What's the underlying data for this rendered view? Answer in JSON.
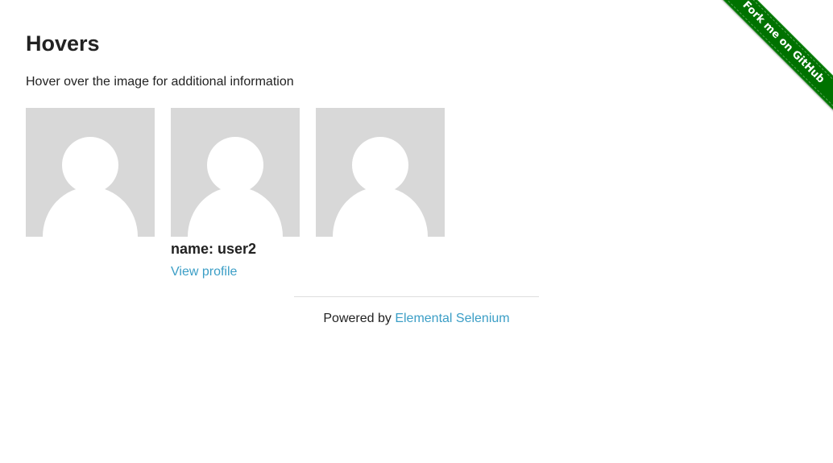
{
  "page": {
    "title": "Hovers",
    "subtitle": "Hover over the image for additional information"
  },
  "figures": [
    {
      "avatar_icon": "user-avatar-icon",
      "caption_name": "",
      "caption_link": ""
    },
    {
      "avatar_icon": "user-avatar-icon",
      "caption_name": "name: user2",
      "caption_link": "View profile"
    },
    {
      "avatar_icon": "user-avatar-icon",
      "caption_name": "",
      "caption_link": ""
    }
  ],
  "footer": {
    "prefix": "Powered by ",
    "link_text": "Elemental Selenium"
  },
  "ribbon": {
    "text": "Fork me on GitHub"
  },
  "colors": {
    "link": "#3b9ec6",
    "avatar_bg": "#d8d8d8",
    "ribbon": "#007200",
    "text": "#222222"
  }
}
